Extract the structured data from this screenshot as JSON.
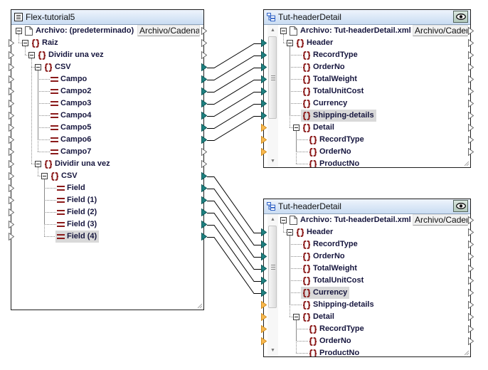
{
  "source": {
    "title": "Flex-tutorial5",
    "icon": "flextext-component-icon",
    "file": {
      "label": "Archivo: (predeterminado)",
      "button": "Archivo/Cadena",
      "out": "unconnected"
    },
    "items": [
      {
        "label": "Raiz",
        "type": "element",
        "depth": 0,
        "expandable": true,
        "in": "unconnected",
        "out": "unconnected"
      },
      {
        "label": "Dividir una vez",
        "type": "element",
        "depth": 1,
        "expandable": true,
        "in": "unconnected",
        "out": "unconnected"
      },
      {
        "label": "CSV",
        "type": "element",
        "depth": 2,
        "expandable": true,
        "in": "unconnected",
        "out": "connected"
      },
      {
        "label": "Campo",
        "type": "field",
        "depth": 3,
        "in": "unconnected",
        "out": "connected"
      },
      {
        "label": "Campo2",
        "type": "field",
        "depth": 3,
        "in": "unconnected",
        "out": "connected"
      },
      {
        "label": "Campo3",
        "type": "field",
        "depth": 3,
        "in": "unconnected",
        "out": "connected"
      },
      {
        "label": "Campo4",
        "type": "field",
        "depth": 3,
        "in": "unconnected",
        "out": "connected"
      },
      {
        "label": "Campo5",
        "type": "field",
        "depth": 3,
        "in": "unconnected",
        "out": "connected"
      },
      {
        "label": "Campo6",
        "type": "field",
        "depth": 3,
        "in": "unconnected",
        "out": "connected"
      },
      {
        "label": "Campo7",
        "type": "field",
        "depth": 3,
        "in": "unconnected",
        "out": "unconnected"
      },
      {
        "label": "Dividir una vez",
        "type": "element",
        "depth": 2,
        "expandable": true,
        "in": "unconnected",
        "out": "unconnected"
      },
      {
        "label": "CSV",
        "type": "element",
        "depth": 3,
        "expandable": true,
        "in": "unconnected",
        "out": "connected"
      },
      {
        "label": "Field",
        "type": "field",
        "depth": 4,
        "in": "unconnected",
        "out": "connected"
      },
      {
        "label": "Field (1)",
        "type": "field",
        "depth": 4,
        "in": "unconnected",
        "out": "connected"
      },
      {
        "label": "Field (2)",
        "type": "field",
        "depth": 4,
        "in": "unconnected",
        "out": "connected"
      },
      {
        "label": "Field (3)",
        "type": "field",
        "depth": 4,
        "in": "unconnected",
        "out": "connected"
      },
      {
        "label": "Field (4)",
        "type": "field",
        "depth": 4,
        "in": "unconnected",
        "out": "connected",
        "highlighted": true
      }
    ]
  },
  "targets": [
    {
      "title": "Tut-headerDetail",
      "icon": "xml-schema-icon",
      "preview_icon": "eye-icon",
      "file": {
        "label": "Archivo: Tut-headerDetail.xml",
        "button": "Archivo/Cadena",
        "out": "unconnected"
      },
      "scroll": {
        "position": 0,
        "visible_fraction": 0.69
      },
      "items": [
        {
          "label": "Header",
          "type": "element",
          "depth": 0,
          "expandable": true,
          "in": "connected",
          "out": "unconnected"
        },
        {
          "label": "RecordType",
          "type": "element",
          "depth": 1,
          "in": "connected",
          "out": "unconnected"
        },
        {
          "label": "OrderNo",
          "type": "element",
          "depth": 1,
          "in": "connected",
          "out": "unconnected"
        },
        {
          "label": "TotalWeight",
          "type": "element",
          "depth": 1,
          "in": "connected",
          "out": "unconnected"
        },
        {
          "label": "TotalUnitCost",
          "type": "element",
          "depth": 1,
          "in": "connected",
          "out": "unconnected"
        },
        {
          "label": "Currency",
          "type": "element",
          "depth": 1,
          "in": "connected",
          "out": "unconnected"
        },
        {
          "label": "Shipping-details",
          "type": "element",
          "depth": 1,
          "in": "connected",
          "out": "unconnected",
          "highlighted": true
        },
        {
          "label": "Detail",
          "type": "element",
          "depth": 1,
          "expandable": true,
          "in": "mandatory",
          "out": "unconnected"
        },
        {
          "label": "RecordType",
          "type": "element",
          "depth": 2,
          "in": "mandatory",
          "out": "unconnected"
        },
        {
          "label": "OrderNo",
          "type": "element",
          "depth": 2,
          "in": "mandatory",
          "out": "unconnected"
        },
        {
          "label": "ProductNo",
          "type": "element",
          "depth": 2,
          "in": null,
          "out": null
        }
      ]
    },
    {
      "title": "Tut-headerDetail",
      "icon": "xml-schema-icon",
      "preview_icon": "eye-icon",
      "file": {
        "label": "Archivo: Tut-headerDetail.xml",
        "button": "Archivo/Cadena",
        "out": "unconnected"
      },
      "scroll": {
        "position": 0,
        "visible_fraction": 0.69
      },
      "items": [
        {
          "label": "Header",
          "type": "element",
          "depth": 0,
          "expandable": true,
          "in": "connected",
          "out": "unconnected"
        },
        {
          "label": "RecordType",
          "type": "element",
          "depth": 1,
          "in": "connected",
          "out": "unconnected"
        },
        {
          "label": "OrderNo",
          "type": "element",
          "depth": 1,
          "in": "connected",
          "out": "unconnected"
        },
        {
          "label": "TotalWeight",
          "type": "element",
          "depth": 1,
          "in": "connected",
          "out": "unconnected"
        },
        {
          "label": "TotalUnitCost",
          "type": "element",
          "depth": 1,
          "in": "connected",
          "out": "unconnected"
        },
        {
          "label": "Currency",
          "type": "element",
          "depth": 1,
          "in": "connected",
          "out": "unconnected",
          "highlighted": true
        },
        {
          "label": "Shipping-details",
          "type": "element",
          "depth": 1,
          "in": "mandatory",
          "out": "unconnected"
        },
        {
          "label": "Detail",
          "type": "element",
          "depth": 1,
          "expandable": true,
          "in": "mandatory",
          "out": "unconnected"
        },
        {
          "label": "RecordType",
          "type": "element",
          "depth": 2,
          "in": "mandatory",
          "out": "unconnected"
        },
        {
          "label": "OrderNo",
          "type": "element",
          "depth": 2,
          "in": "mandatory",
          "out": "unconnected"
        },
        {
          "label": "ProductNo",
          "type": "element",
          "depth": 2,
          "in": null,
          "out": null
        }
      ]
    }
  ],
  "connections": [
    {
      "from_item": 2,
      "target": 0,
      "to_item": 0
    },
    {
      "from_item": 3,
      "target": 0,
      "to_item": 1
    },
    {
      "from_item": 4,
      "target": 0,
      "to_item": 2
    },
    {
      "from_item": 5,
      "target": 0,
      "to_item": 3
    },
    {
      "from_item": 6,
      "target": 0,
      "to_item": 4
    },
    {
      "from_item": 7,
      "target": 0,
      "to_item": 5
    },
    {
      "from_item": 8,
      "target": 0,
      "to_item": 6
    },
    {
      "from_item": 11,
      "target": 1,
      "to_item": 0
    },
    {
      "from_item": 12,
      "target": 1,
      "to_item": 1
    },
    {
      "from_item": 13,
      "target": 1,
      "to_item": 2
    },
    {
      "from_item": 14,
      "target": 1,
      "to_item": 3
    },
    {
      "from_item": 15,
      "target": 1,
      "to_item": 4
    },
    {
      "from_item": 16,
      "target": 1,
      "to_item": 5
    }
  ],
  "colors": {
    "connected": "#1f8080",
    "connected_stroke": "#0f5a5a",
    "mandatory": "#f8b84e",
    "mandatory_stroke": "#d08f24",
    "unconnected": "#ffffff",
    "unconnected_stroke": "#6a6a6a",
    "wire": "#000000",
    "item_icon": "#8b1a1a"
  }
}
